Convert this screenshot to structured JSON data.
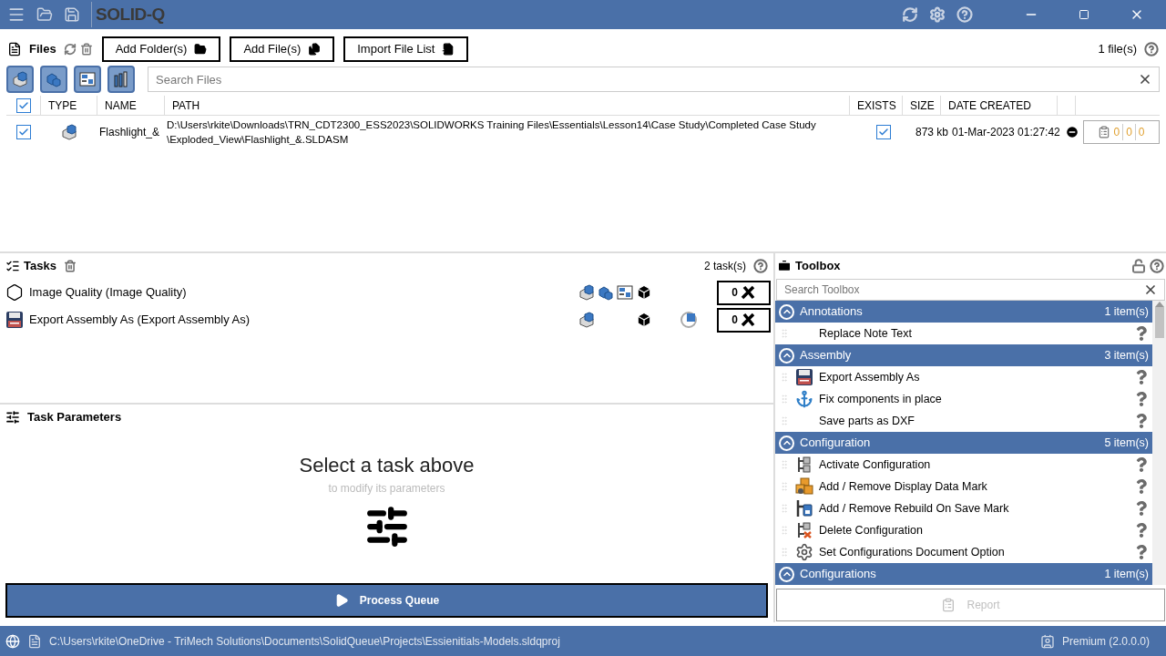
{
  "app": {
    "logo": "SOLID-Q"
  },
  "files": {
    "title": "Files",
    "buttons": [
      "Add Folder(s)",
      "Add File(s)",
      "Import File List"
    ],
    "count": "1 file(s)",
    "search_placeholder": "Search Files",
    "all_checked": true,
    "columns": [
      "TYPE",
      "NAME",
      "PATH",
      "EXISTS",
      "SIZE",
      "DATE CREATED"
    ],
    "rows": [
      {
        "checked": true,
        "name": "Flashlight_&",
        "path": [
          "D:\\Users\\rkite\\Downloads\\TRN_CDT2300_ESS2023\\SOLIDWORKS Training Files\\Essentials\\Lesson14\\Case Study\\Completed Case Study",
          "\\Exploded_View\\Flashlight_&.SLDASM"
        ],
        "exists": true,
        "size": "873 kb",
        "date": "01-Mar-2023 01:27:42",
        "counts": [
          "0",
          "0",
          "0"
        ]
      }
    ]
  },
  "tasks": {
    "title": "Tasks",
    "count": "2 task(s)",
    "items": [
      {
        "name": "Image Quality (Image Quality)",
        "kind": "hexagon",
        "types": [
          {
            "kind": "part"
          },
          {
            "kind": "assembly"
          },
          {
            "kind": "drawing"
          },
          {
            "kind": "box"
          }
        ],
        "pending": false,
        "count": "0"
      },
      {
        "name": "Export Assembly As (Export Assembly As)",
        "kind": "floppy",
        "types": [
          {
            "kind": "part"
          },
          {
            "kind": "blank"
          },
          {
            "kind": "blank"
          },
          {
            "kind": "box"
          }
        ],
        "pending": true,
        "count": "0"
      }
    ]
  },
  "parameters": {
    "title": "Task Parameters",
    "heading": "Select a task above",
    "subheading": "to modify its parameters"
  },
  "process_button": "Process Queue",
  "report_button": {
    "label": "Report",
    "disabled": true
  },
  "toolbox": {
    "title": "Toolbox",
    "search_placeholder": "Search Toolbox",
    "groups": [
      {
        "name": "Annotations",
        "count": "1 item(s)",
        "expanded": true,
        "items": [
          {
            "name": "Replace Note Text",
            "kind": "blank"
          }
        ]
      },
      {
        "name": "Assembly",
        "count": "3 item(s)",
        "expanded": true,
        "items": [
          {
            "name": "Export Assembly As",
            "kind": "floppy"
          },
          {
            "name": "Fix components in place",
            "kind": "anchor"
          },
          {
            "name": "Save parts as DXF",
            "kind": "blank"
          }
        ]
      },
      {
        "name": "Configuration",
        "count": "5 item(s)",
        "expanded": true,
        "items": [
          {
            "name": "Activate Configuration",
            "kind": "config"
          },
          {
            "name": "Add / Remove Display Data Mark",
            "kind": "display"
          },
          {
            "name": "Add / Remove Rebuild On Save Mark",
            "kind": "rebuild"
          },
          {
            "name": "Delete Configuration",
            "kind": "delete"
          },
          {
            "name": "Set Configurations Document Option",
            "kind": "gear"
          }
        ]
      },
      {
        "name": "Configurations",
        "count": "1 item(s)",
        "expanded": true
      }
    ]
  },
  "status": {
    "path": "C:\\Users\\rkite\\OneDrive - TriMech Solutions\\Documents\\SolidQueue\\Projects\\Essienitials-Models.sldqproj",
    "edition": "Premium (2.0.0.0)"
  }
}
